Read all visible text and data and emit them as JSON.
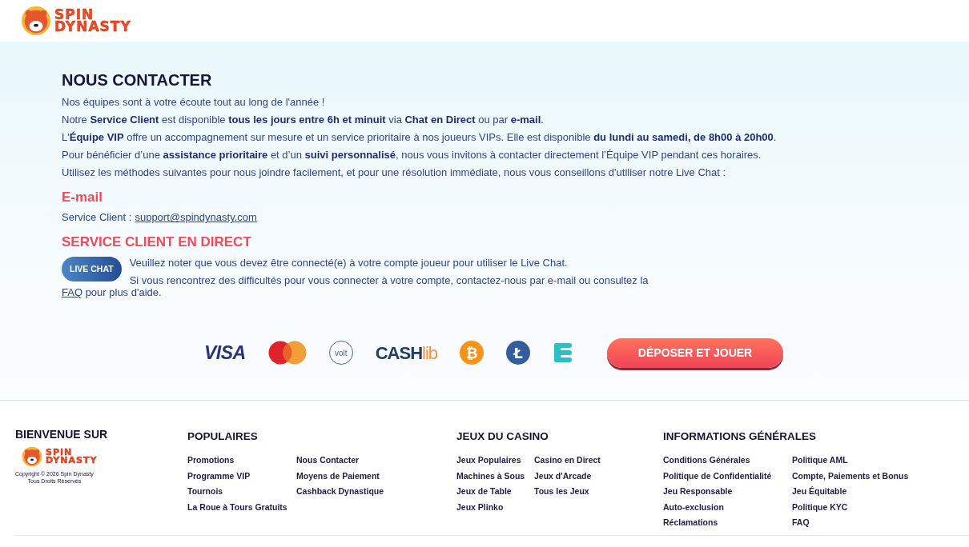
{
  "header": {
    "logo": [
      "SPIN",
      "DYNASTY"
    ]
  },
  "contact": {
    "title": "NOUS CONTACTER",
    "paragraphs": [
      "Nos équipes sont à votre écoute tout au long de l'année !",
      "Notre **Service Client** est disponible **tous les jours entre 6h et minuit** via **Chat en Direct** ou par **e-mail**.",
      "L'**Équipe VIP** offre un accompagnement sur mesure et un service prioritaire à nos joueurs VIPs. Elle est disponible **du lundi au samedi, de 8h00 à 20h00**.",
      "Pour bénéficier d’une **assistance prioritaire** et d’un **suivi personnalisé**, nous vous invitons à contacter directement l’Équipe VIP pendant ces horaires.",
      "Utilisez les méthodes suivantes pour nous joindre facilement, et pour une résolution immédiate, nous vous conseillons d'utiliser notre Live Chat :"
    ],
    "email": {
      "heading": "E-mail",
      "label": "Service Client :",
      "address": "support@spindynasty.com"
    },
    "live": {
      "heading": "SERVICE CLIENT EN DIRECT",
      "button": "LIVE CHAT",
      "note": "Veuillez noter que vous devez être connecté(e) à votre compte joueur pour utiliser le Live Chat.",
      "help_before": "Si vous rencontrez des difficultés pour vous connecter à votre compte, contactez-nous par e-mail ou consultez la",
      "help_link": "FAQ",
      "help_after": "pour plus d'aide."
    }
  },
  "payments": [
    {
      "kind": "visa",
      "label": "VISA"
    },
    {
      "kind": "mastercard"
    },
    {
      "kind": "volt",
      "label": "volt"
    },
    {
      "kind": "cashlib",
      "label": "CASH",
      "suffix": "lib"
    },
    {
      "kind": "coin",
      "color": "#f7931a",
      "label": "₿"
    },
    {
      "kind": "coin",
      "color": "#345d9d",
      "label": "Ł"
    },
    {
      "kind": "bars"
    }
  ],
  "cta": "DÉPOSER ET JOUER",
  "footer": {
    "welcome": "BIENVENUE SUR",
    "logo": [
      "SPIN",
      "DYNASTY"
    ],
    "copyright": [
      "Copyright © 2026 Spin Dynasty",
      "Tous Droits Réservés"
    ],
    "columns": [
      {
        "title": "POPULAIRES",
        "links": [
          [
            "Promotions",
            "Programme VIP",
            "Tournois",
            "La Roue à Tours Gratuits"
          ],
          [
            "Nous Contacter",
            "Moyens de Paiement",
            "Cashback Dynastique"
          ]
        ]
      },
      {
        "title": "JEUX DU CASINO",
        "links": [
          [
            "Jeux Populaires",
            "Machines à Sous",
            "Jeux de Table",
            "Jeux Plinko"
          ],
          [
            "Casino en Direct",
            "Jeux d'Arcade",
            "Tous les Jeux"
          ]
        ]
      },
      {
        "title": "INFORMATIONS GÉNÉRALES",
        "links": [
          [
            "Conditions Générales",
            "Politique de Confidentialité",
            "Jeu Responsable",
            "Auto-exclusion",
            "Réclamations"
          ],
          [
            "Politique AML",
            "Compte, Paiements et Bonus",
            "Jeu Équitable",
            "Politique KYC",
            "FAQ"
          ]
        ]
      }
    ]
  }
}
